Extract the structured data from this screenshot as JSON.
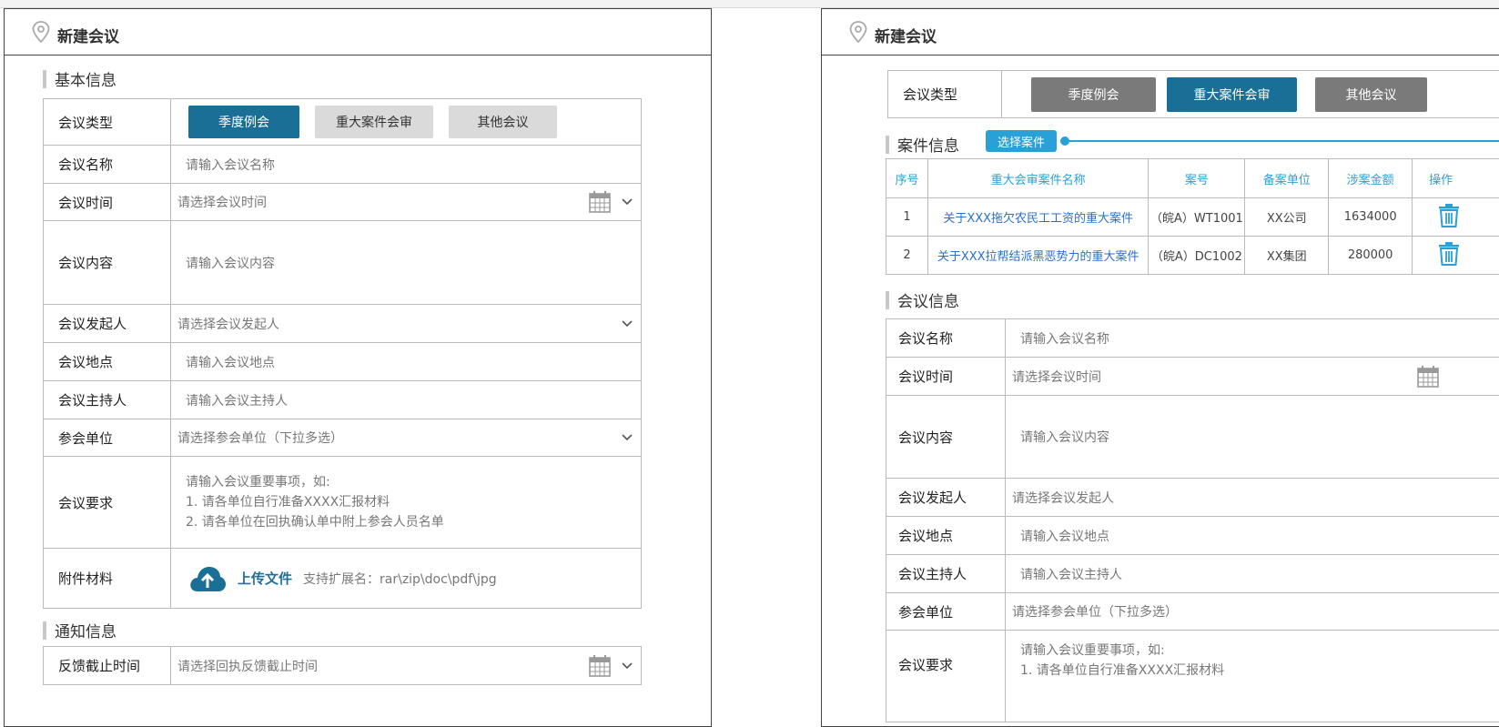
{
  "left_panel": {
    "title": "新建会议",
    "section_basic": "基本信息",
    "section_notice": "通知信息",
    "type": {
      "label": "会议类型",
      "options": [
        "季度例会",
        "重大案件会审",
        "其他会议"
      ],
      "selected": 0
    },
    "rows": {
      "name": {
        "label": "会议名称",
        "placeholder": "请输入会议名称"
      },
      "time": {
        "label": "会议时间",
        "placeholder": "请选择会议时间"
      },
      "content": {
        "label": "会议内容",
        "placeholder": "请输入会议内容"
      },
      "initiator": {
        "label": "会议发起人",
        "placeholder": "请选择会议发起人"
      },
      "location": {
        "label": "会议地点",
        "placeholder": "请输入会议地点"
      },
      "host": {
        "label": "会议主持人",
        "placeholder": "请输入会议主持人"
      },
      "units": {
        "label": "参会单位",
        "placeholder": "请选择参会单位（下拉多选）"
      },
      "requirements": {
        "label": "会议要求",
        "lines": [
          "请输入会议重要事项，如:",
          "1. 请各单位自行准备XXXX汇报材料",
          "2. 请各单位在回执确认单中附上参会人员名单"
        ]
      },
      "attachment": {
        "label": "附件材料",
        "upload_label": "上传文件",
        "hint": "支持扩展名：rar\\zip\\doc\\pdf\\jpg"
      },
      "deadline": {
        "label": "反馈截止时间",
        "placeholder": "请选择回执反馈截止时间"
      }
    }
  },
  "right_panel": {
    "title": "新建会议",
    "type": {
      "label": "会议类型",
      "options": [
        "季度例会",
        "重大案件会审",
        "其他会议"
      ],
      "selected": 1
    },
    "case_section": {
      "title": "案件信息",
      "select_button": "选择案件"
    },
    "case_table": {
      "headers": [
        "序号",
        "重大会审案件名称",
        "案号",
        "备案单位",
        "涉案金额",
        "操作"
      ],
      "rows": [
        {
          "no": "1",
          "name": "关于XXX拖欠农民工工资的重大案件",
          "case_no": "（皖A）WT1001",
          "unit": "XX公司",
          "amount": "1634000"
        },
        {
          "no": "2",
          "name": "关于XXX拉帮结派黑恶势力的重大案件",
          "case_no": "（皖A）DC1002",
          "unit": "XX集团",
          "amount": "280000"
        }
      ]
    },
    "meeting_section": "会议信息",
    "rows": {
      "name": {
        "label": "会议名称",
        "placeholder": "请输入会议名称"
      },
      "time": {
        "label": "会议时间",
        "placeholder": "请选择会议时间"
      },
      "content": {
        "label": "会议内容",
        "placeholder": "请输入会议内容"
      },
      "initiator": {
        "label": "会议发起人",
        "placeholder": "请选择会议发起人"
      },
      "location": {
        "label": "会议地点",
        "placeholder": "请输入会议地点"
      },
      "host": {
        "label": "会议主持人",
        "placeholder": "请输入会议主持人"
      },
      "units": {
        "label": "参会单位",
        "placeholder": "请选择参会单位（下拉多选）"
      },
      "requirements": {
        "label": "会议要求",
        "lines": [
          "请输入会议重要事项，如:",
          "1. 请各单位自行准备XXXX汇报材料"
        ]
      }
    }
  },
  "colors": {
    "primary": "#1a6f96",
    "secondary_gray": "#dadada",
    "dark_gray": "#7a7a7a",
    "accent_blue": "#2aa1d6"
  }
}
